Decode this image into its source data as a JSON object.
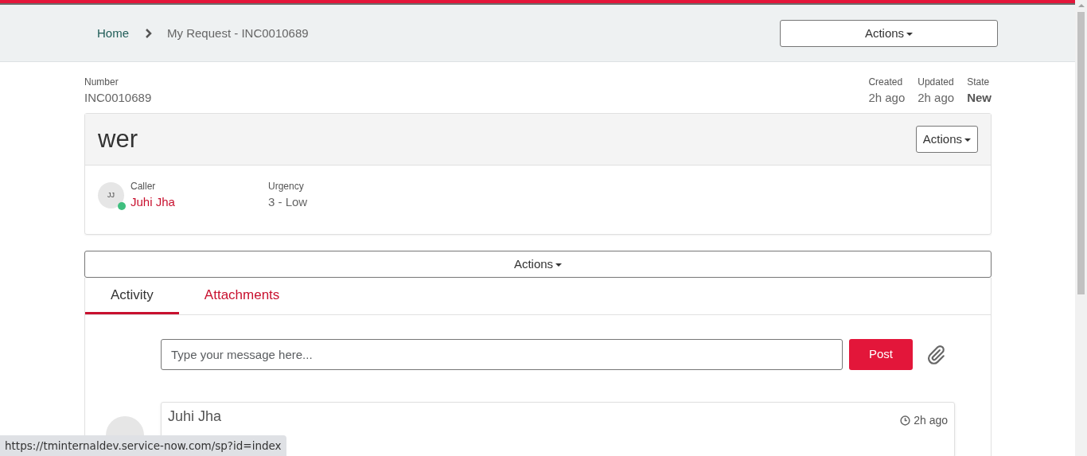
{
  "breadcrumb": [
    {
      "label": "Home",
      "kind": "link"
    },
    {
      "label": "My Request - INC0010689",
      "kind": "current"
    }
  ],
  "header_actions": "Actions",
  "record": {
    "number_label": "Number",
    "number": "INC0010689",
    "meta": [
      {
        "label": "Created",
        "value": "2h ago",
        "kind": "plain"
      },
      {
        "label": "Updated",
        "value": "2h ago",
        "kind": "plain"
      },
      {
        "label": "State",
        "value": "New",
        "kind": "strong"
      }
    ]
  },
  "ticket": {
    "title": "wer",
    "actions": "Actions",
    "caller": {
      "initials": "JJ",
      "online": true,
      "label": "Caller",
      "name": "Juhi Jha"
    },
    "fields": [
      {
        "label": "Urgency",
        "value": "3 - Low"
      }
    ]
  },
  "actions_bar": "Actions",
  "tabs": [
    {
      "label": "Activity",
      "selected": true
    },
    {
      "label": "Attachments",
      "selected": false
    }
  ],
  "composer": {
    "placeholder": "Type your message here...",
    "button": "Post"
  },
  "entries": [
    {
      "author": "Juhi Jha",
      "time": "2h ago"
    }
  ],
  "status_url": "https://tminternaldev.service-now.com/sp?id=index"
}
